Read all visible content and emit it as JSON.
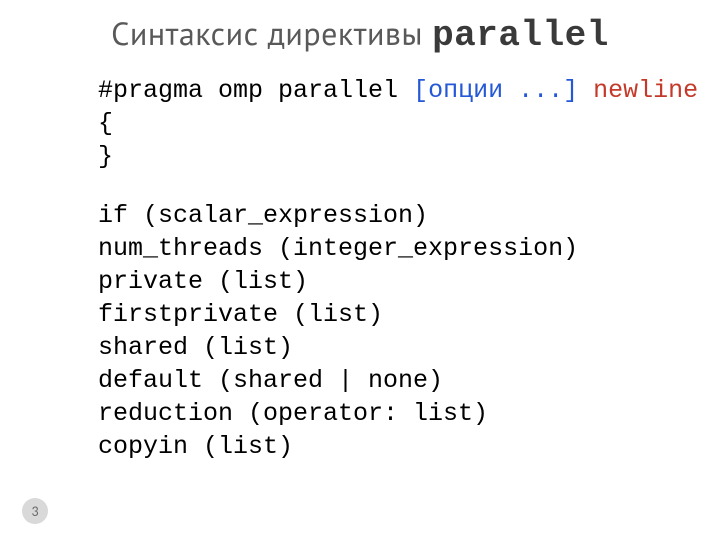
{
  "title": {
    "text": "Синтаксис директивы ",
    "mono": "parallel"
  },
  "code": {
    "line1_a": "#pragma omp parallel ",
    "line1_opt": "[опции ...]",
    "line1_sp": " ",
    "line1_kw": "newline",
    "line2": "{",
    "line3": "",
    "line4": "}",
    "line5": "if (scalar_expression)",
    "line6": "num_threads (integer_expression)",
    "line7": "private (list)",
    "line8": "firstprivate (list)",
    "line9": "shared (list)",
    "line10": "default (shared | none)",
    "line11": "reduction (operator: list)",
    "line12": "copyin (list)"
  },
  "page_number": "3"
}
